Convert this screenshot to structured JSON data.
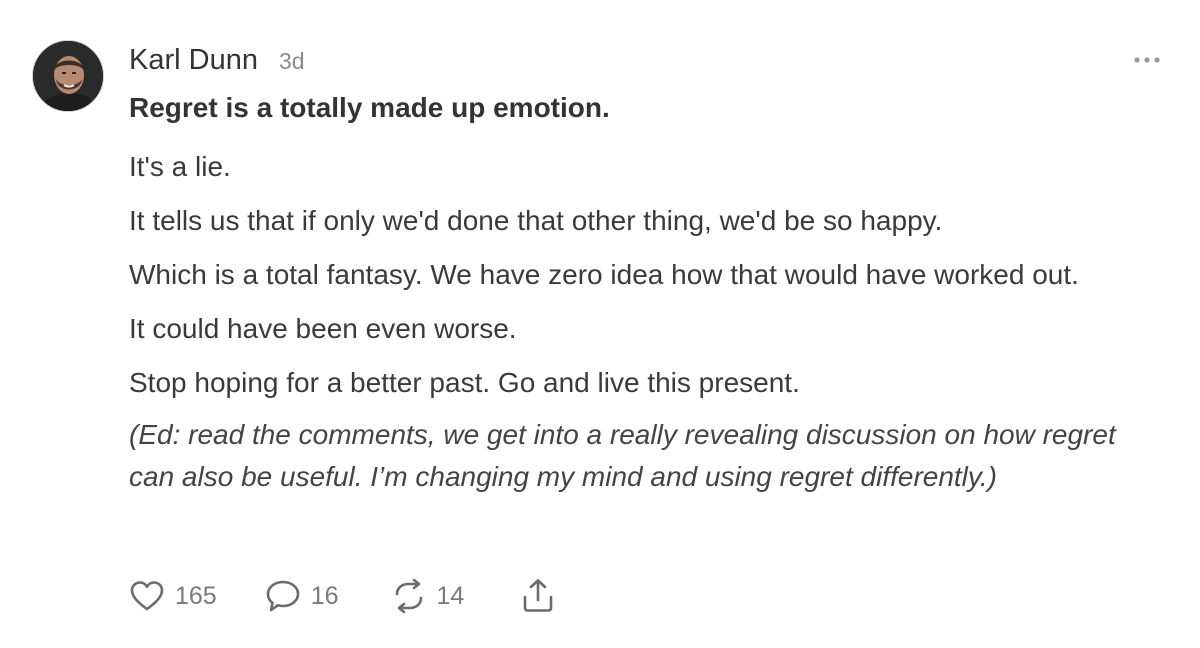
{
  "post": {
    "author": "Karl Dunn",
    "time": "3d",
    "title": "Regret is a totally made up emotion.",
    "paragraphs": [
      "It's a lie.",
      "It tells us that if only we'd done that other thing, we'd be so happy.",
      "Which is a total fantasy. We have zero idea how that would have worked out.",
      "It could have been even worse.",
      "Stop hoping for a better past. Go and live this present."
    ],
    "note": "(Ed: read the comments, we get into a really revealing discussion on how regret can also be useful. I’m changing my mind and using regret differently.)"
  },
  "actions": {
    "likes": "165",
    "comments": "16",
    "restacks": "14"
  },
  "icons": {
    "avatar": "avatar",
    "more": "more-icon",
    "like": "heart-icon",
    "comment": "comment-icon",
    "restack": "restack-icon",
    "share": "share-icon"
  },
  "colors": {
    "text": "#3a3a3a",
    "muted": "#7a7a7a",
    "icon": "#6b6b6b"
  }
}
